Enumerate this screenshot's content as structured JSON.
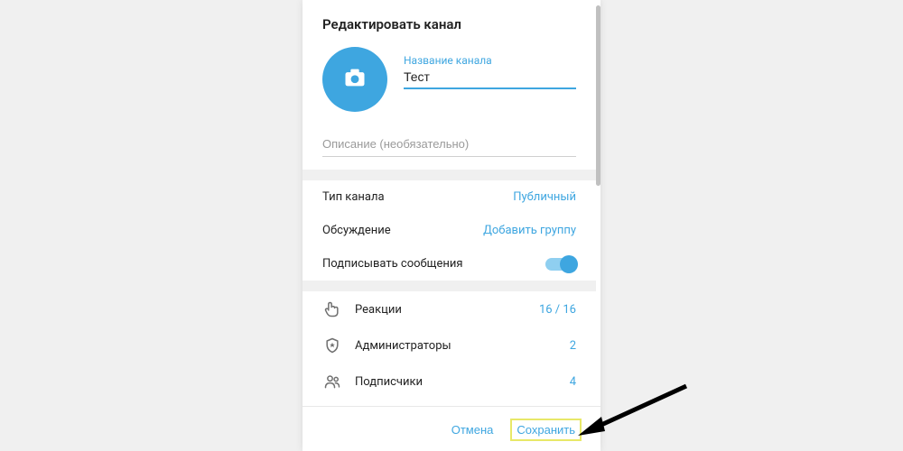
{
  "dialog": {
    "title": "Редактировать канал",
    "name_label": "Название канала",
    "name_value": "Тест",
    "description_placeholder": "Описание (необязательно)"
  },
  "settings": {
    "type_label": "Тип канала",
    "type_value": "Публичный",
    "discussion_label": "Обсуждение",
    "discussion_value": "Добавить группу",
    "sign_label": "Подписывать сообщения",
    "sign_on": true
  },
  "lists": {
    "reactions_label": "Реакции",
    "reactions_value": "16 / 16",
    "admins_label": "Администраторы",
    "admins_value": "2",
    "subscribers_label": "Подписчики",
    "subscribers_value": "4"
  },
  "footer": {
    "cancel": "Отмена",
    "save": "Сохранить"
  }
}
